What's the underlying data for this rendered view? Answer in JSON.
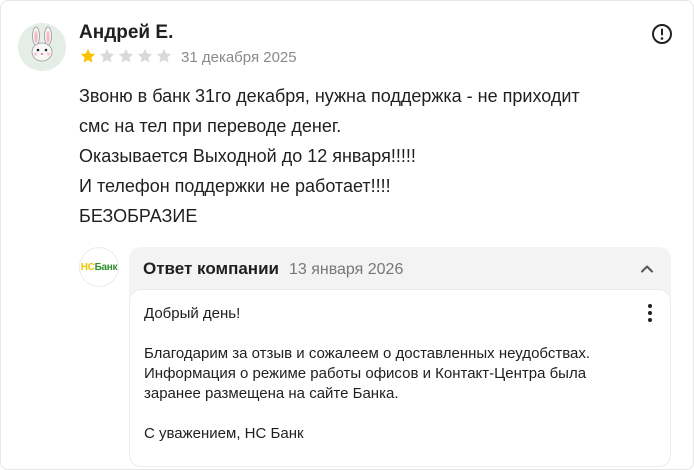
{
  "review": {
    "author": "Андрей Е.",
    "rating": 1,
    "max_rating": 5,
    "date": "31 декабря 2025",
    "text_lines": [
      "Звоню в банк 31го декабря, нужна поддержка - не приходит",
      "смс на тел при переводе денег.",
      "Оказывается Выходной до 12 января!!!!!",
      "И телефон поддержки не работает!!!!",
      "БЕЗОБРАЗИЕ"
    ]
  },
  "company_reply": {
    "logo": {
      "part1": "НС",
      "part2": "Банк",
      "color1": "#f1c400",
      "color2": "#2e8b2e"
    },
    "title": "Ответ компании",
    "date": "13 января 2026",
    "greeting": "Добрый день!",
    "body_lines": [
      "Благодарим за отзыв и сожалеем о доставленных неудобствах.",
      "Информация о режиме работы офисов и Контакт-Центра была",
      "заранее размещена на сайте Банка."
    ],
    "signature": "С уважением, НС Банк"
  },
  "colors": {
    "star_filled": "#fcc200",
    "star_empty": "#d9d9d9",
    "reply_bg": "#f3f3f4"
  },
  "icons": {
    "avatar": "bunny-avatar-icon",
    "more": "exclamation-circle-icon",
    "collapse": "chevron-up-icon",
    "menu": "kebab-menu-icon"
  }
}
